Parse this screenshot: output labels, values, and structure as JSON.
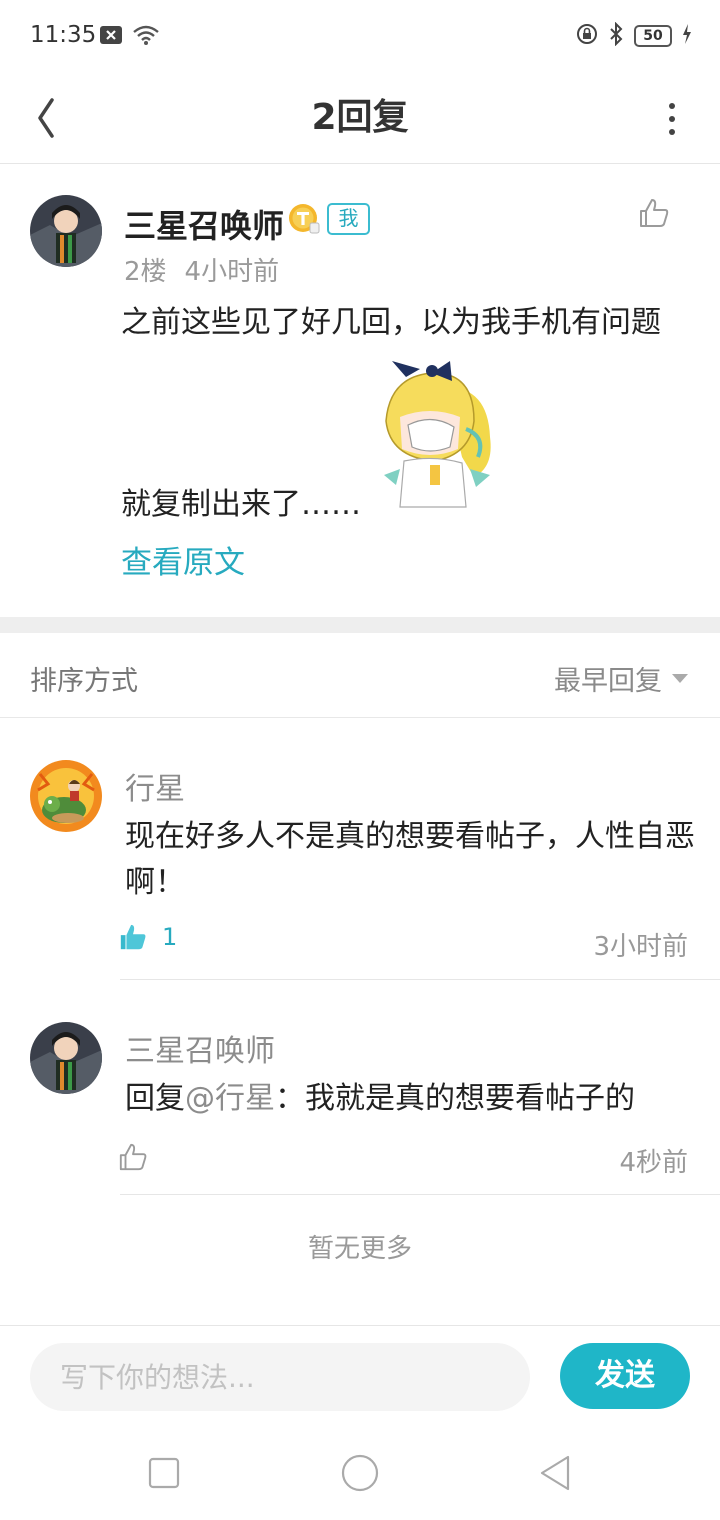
{
  "status_bar": {
    "time": "11:35",
    "battery_level": "50",
    "icons": [
      "notification-x-icon",
      "wifi-icon",
      "rotation-lock-icon",
      "bluetooth-icon",
      "battery-icon",
      "charging-icon"
    ]
  },
  "header": {
    "title": "2回复",
    "back_icon": "chevron-left-icon",
    "more_icon": "more-vertical-icon"
  },
  "post": {
    "author": "三星召唤师",
    "me_tag": "我",
    "floor": "2楼",
    "time": "4小时前",
    "text_line1": "之前这些见了好几回，以为我手机有问题",
    "text_line2": "就复制出来了……",
    "view_original": "查看原文"
  },
  "sort": {
    "label": "排序方式",
    "selected": "最早回复"
  },
  "replies": [
    {
      "author": "行星",
      "text": "现在好多人不是真的想要看帖子，人性自恶啊！",
      "likes": "1",
      "time": "3小时前"
    },
    {
      "author": "三星召唤师",
      "reply_prefix": "回复",
      "mention": "@行星",
      "text": "：我就是真的想要看帖子的",
      "time": "4秒前"
    }
  ],
  "footer_note": "暂无更多",
  "input": {
    "placeholder": "写下你的想法...",
    "send_label": "发送"
  },
  "colors": {
    "accent": "#1fb6c8",
    "link": "#27aabf"
  }
}
